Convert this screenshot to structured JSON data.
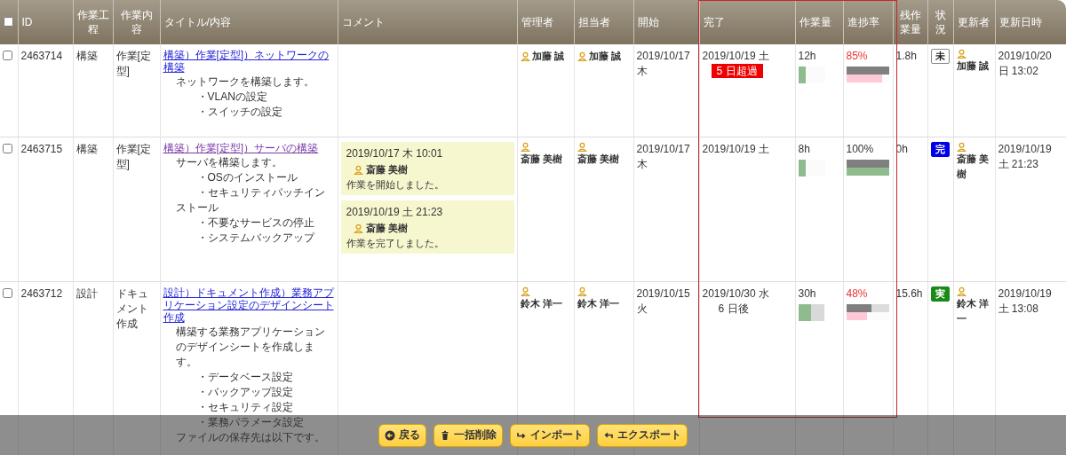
{
  "columns": [
    "ID",
    "作業工程",
    "作業内容",
    "タイトル/内容",
    "コメント",
    "管理者",
    "担当者",
    "開始",
    "完了",
    "作業量",
    "進捗率",
    "残作業量",
    "状況",
    "更新者",
    "更新日時"
  ],
  "select_all": {
    "checked": false
  },
  "rows": [
    {
      "checked": false,
      "id": "2463714",
      "process": "構築",
      "work": "作業[定型]",
      "title": "構築）作業[定型]）ネットワークの構築",
      "visited": false,
      "description": [
        {
          "text": "ネットワークを構築します。",
          "indented": false
        },
        {
          "text": "・VLANの設定",
          "indented": true
        },
        {
          "text": "・スイッチの設定",
          "indented": true
        }
      ],
      "comments": [],
      "manager": "加藤 誠",
      "assignee": "加藤 誠",
      "start": "2019/10/17 木",
      "due": "2019/10/19 土",
      "due_note": {
        "kind": "overdue",
        "text": "5 日超過"
      },
      "workload": "12h",
      "workload_bars": [
        {
          "kind": "done",
          "level": 0.27
        }
      ],
      "progress": "85%",
      "behind": true,
      "plan_bar": {
        "level": 1
      },
      "progress_bar": {
        "level": 0.85,
        "complete": false
      },
      "remaining": "1.8h",
      "status": {
        "kind": "not_started",
        "text": "未"
      },
      "updated_by": "加藤 誠",
      "updated_at": "2019/10/20 日 13:02"
    },
    {
      "checked": false,
      "id": "2463715",
      "process": "構築",
      "work": "作業[定型]",
      "title": "構築）作業[定型]）サーバの構築",
      "visited": true,
      "description": [
        {
          "text": "サーバを構築します。",
          "indented": false
        },
        {
          "text": "・OSのインストール",
          "indented": true
        },
        {
          "text": "・セキュリティパッチインストール",
          "indented": true
        },
        {
          "text": "・不要なサービスの停止",
          "indented": true
        },
        {
          "text": "・システムバックアップ",
          "indented": true
        }
      ],
      "comments": [
        {
          "date": "2019/10/17 木 10:01",
          "author": "斎藤 美樹",
          "text": "作業を開始しました。"
        },
        {
          "date": "2019/10/19 土 21:23",
          "author": "斎藤 美樹",
          "text": "作業を完了しました。"
        }
      ],
      "manager": "斎藤 美樹",
      "assignee": "斎藤 美樹",
      "start": "2019/10/17 木",
      "due": "2019/10/19 土",
      "workload": "8h",
      "workload_bars": [
        {
          "kind": "done",
          "level": 0.27
        }
      ],
      "progress": "100%",
      "behind": false,
      "plan_bar": {
        "level": 1
      },
      "progress_bar": {
        "level": 1,
        "complete": true
      },
      "remaining": "0h",
      "status": {
        "kind": "done",
        "text": "完"
      },
      "updated_by": "斎藤 美樹",
      "updated_at": "2019/10/19 土 21:23"
    },
    {
      "checked": false,
      "id": "2463712",
      "process": "設計",
      "work": "ドキュメント作成",
      "title": "設計）ドキュメント作成）業務アプリケーション設定のデザインシート作成",
      "visited": false,
      "description": [
        {
          "text": "構築する業務アプリケーションのデザインシートを作成します。",
          "indented": false
        },
        {
          "text": "・データベース設定",
          "indented": true
        },
        {
          "text": "・バックアップ設定",
          "indented": true
        },
        {
          "text": "・セキュリティ設定",
          "indented": true
        },
        {
          "text": "・業務パラメータ設定",
          "indented": true
        },
        {
          "text": "ファイルの保存先は以下です。",
          "indented": false
        }
      ],
      "comments": [],
      "manager": "鈴木 洋一",
      "assignee": "鈴木 洋一",
      "start": "2019/10/15 火",
      "due": "2019/10/30 水",
      "due_note": {
        "kind": "remaining",
        "text": "6 日後"
      },
      "workload": "30h",
      "workload_bars": [
        {
          "kind": "done",
          "level": 0.47
        },
        {
          "kind": "remaining",
          "level": 0.53
        }
      ],
      "progress": "48%",
      "behind": true,
      "plan_bar": {
        "level": 0.6
      },
      "progress_bar": {
        "level": 0.48,
        "complete": false
      },
      "remaining": "15.6h",
      "status": {
        "kind": "in_progress",
        "text": "実"
      },
      "updated_by": "鈴木 洋一",
      "updated_at": "2019/10/19 土 13:08"
    }
  ],
  "buttons": [
    {
      "label": "戻る",
      "kind": "back"
    },
    {
      "label": "一括削除",
      "kind": "delete"
    },
    {
      "label": "インポート",
      "kind": "import"
    },
    {
      "label": "エクスポート",
      "kind": "export"
    }
  ]
}
